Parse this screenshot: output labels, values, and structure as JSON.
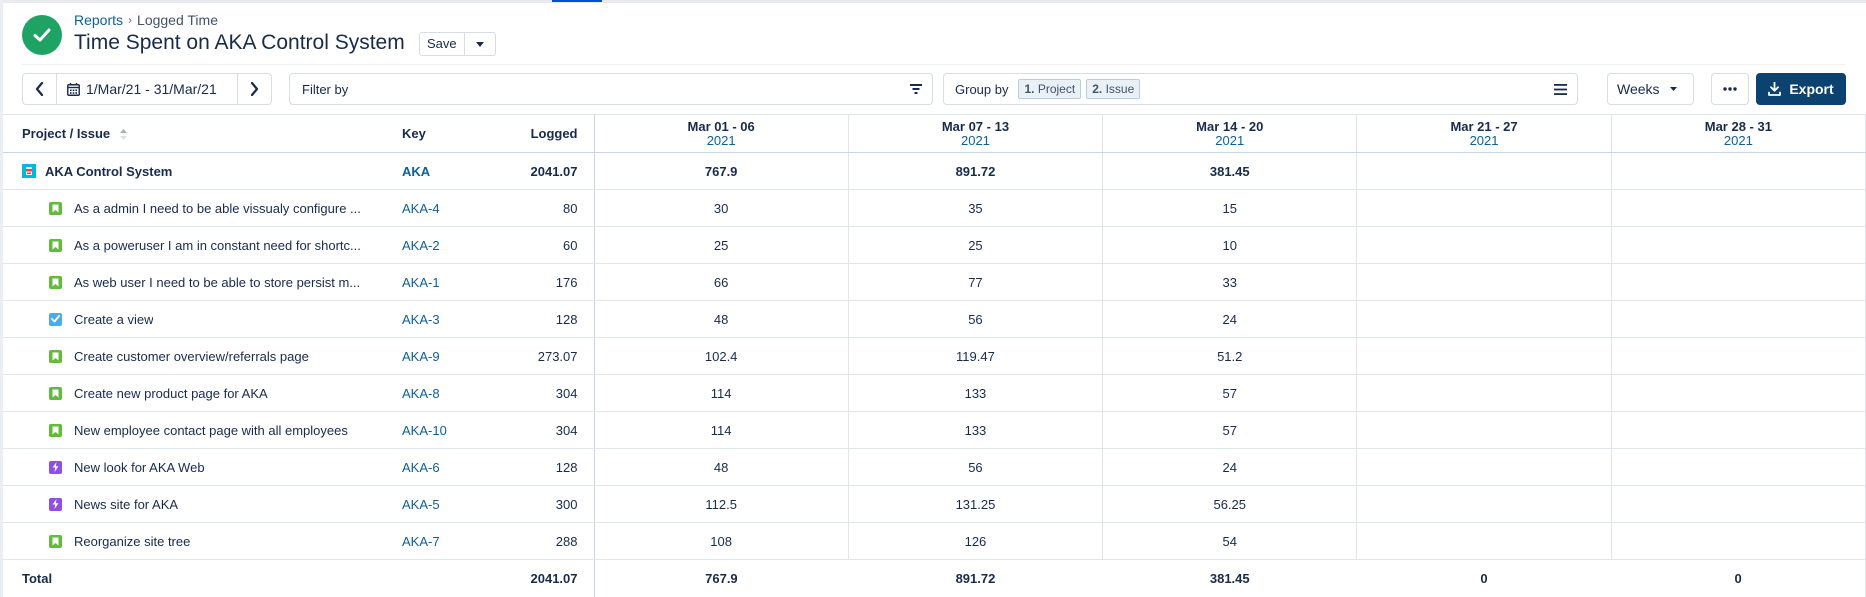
{
  "header": {
    "breadcrumb": {
      "parent": "Reports",
      "separator": "›",
      "current": "Logged Time"
    },
    "title": "Time Spent on AKA Control System",
    "save_label": "Save"
  },
  "toolbar": {
    "date_range": "1/Mar/21 - 31/Mar/21",
    "filter_placeholder": "Filter by",
    "group_by_label": "Group by",
    "group_chips": [
      {
        "num": "1.",
        "label": "Project"
      },
      {
        "num": "2.",
        "label": "Issue"
      }
    ],
    "period_select": "Weeks",
    "more_label": "•••",
    "export_label": "Export"
  },
  "table": {
    "columns": {
      "name": "Project / Issue",
      "key": "Key",
      "logged": "Logged"
    },
    "weeks": [
      {
        "range": "Mar 01 - 06",
        "year": "2021"
      },
      {
        "range": "Mar 07 - 13",
        "year": "2021"
      },
      {
        "range": "Mar 14 - 20",
        "year": "2021"
      },
      {
        "range": "Mar 21 - 27",
        "year": "2021"
      },
      {
        "range": "Mar 28 - 31",
        "year": "2021"
      }
    ],
    "project": {
      "name": "AKA Control System",
      "key": "AKA",
      "logged": "2041.07",
      "weeks": [
        "767.9",
        "891.72",
        "381.45",
        "",
        ""
      ]
    },
    "issues": [
      {
        "type": "story",
        "name": "As a admin I need to be able vissualy configure ...",
        "key": "AKA-4",
        "logged": "80",
        "weeks": [
          "30",
          "35",
          "15",
          "",
          ""
        ]
      },
      {
        "type": "story",
        "name": "As a poweruser I am in constant need for shortc...",
        "key": "AKA-2",
        "logged": "60",
        "weeks": [
          "25",
          "25",
          "10",
          "",
          ""
        ]
      },
      {
        "type": "story",
        "name": "As web user I need to be able to store persist m...",
        "key": "AKA-1",
        "logged": "176",
        "weeks": [
          "66",
          "77",
          "33",
          "",
          ""
        ]
      },
      {
        "type": "task",
        "name": "Create a view",
        "key": "AKA-3",
        "logged": "128",
        "weeks": [
          "48",
          "56",
          "24",
          "",
          ""
        ]
      },
      {
        "type": "story",
        "name": "Create customer overview/referrals page",
        "key": "AKA-9",
        "logged": "273.07",
        "weeks": [
          "102.4",
          "119.47",
          "51.2",
          "",
          ""
        ]
      },
      {
        "type": "story",
        "name": "Create new product page for AKA",
        "key": "AKA-8",
        "logged": "304",
        "weeks": [
          "114",
          "133",
          "57",
          "",
          ""
        ]
      },
      {
        "type": "story",
        "name": "New employee contact page with all employees",
        "key": "AKA-10",
        "logged": "304",
        "weeks": [
          "114",
          "133",
          "57",
          "",
          ""
        ]
      },
      {
        "type": "epic",
        "name": "New look for AKA Web",
        "key": "AKA-6",
        "logged": "128",
        "weeks": [
          "48",
          "56",
          "24",
          "",
          ""
        ]
      },
      {
        "type": "epic",
        "name": "News site for AKA",
        "key": "AKA-5",
        "logged": "300",
        "weeks": [
          "112.5",
          "131.25",
          "56.25",
          "",
          ""
        ]
      },
      {
        "type": "story",
        "name": "Reorganize site tree",
        "key": "AKA-7",
        "logged": "288",
        "weeks": [
          "108",
          "126",
          "54",
          "",
          ""
        ]
      }
    ],
    "total": {
      "label": "Total",
      "logged": "2041.07",
      "weeks": [
        "767.9",
        "891.72",
        "381.45",
        "0",
        "0"
      ]
    }
  },
  "colors": {
    "success_logo": "#1fa364",
    "link": "#0c5e9c",
    "export_button": "#0b4270",
    "story_icon": "#63ba3c",
    "task_icon": "#4bade8",
    "epic_icon": "#904ee2",
    "project_icon": "#00b8d9"
  }
}
